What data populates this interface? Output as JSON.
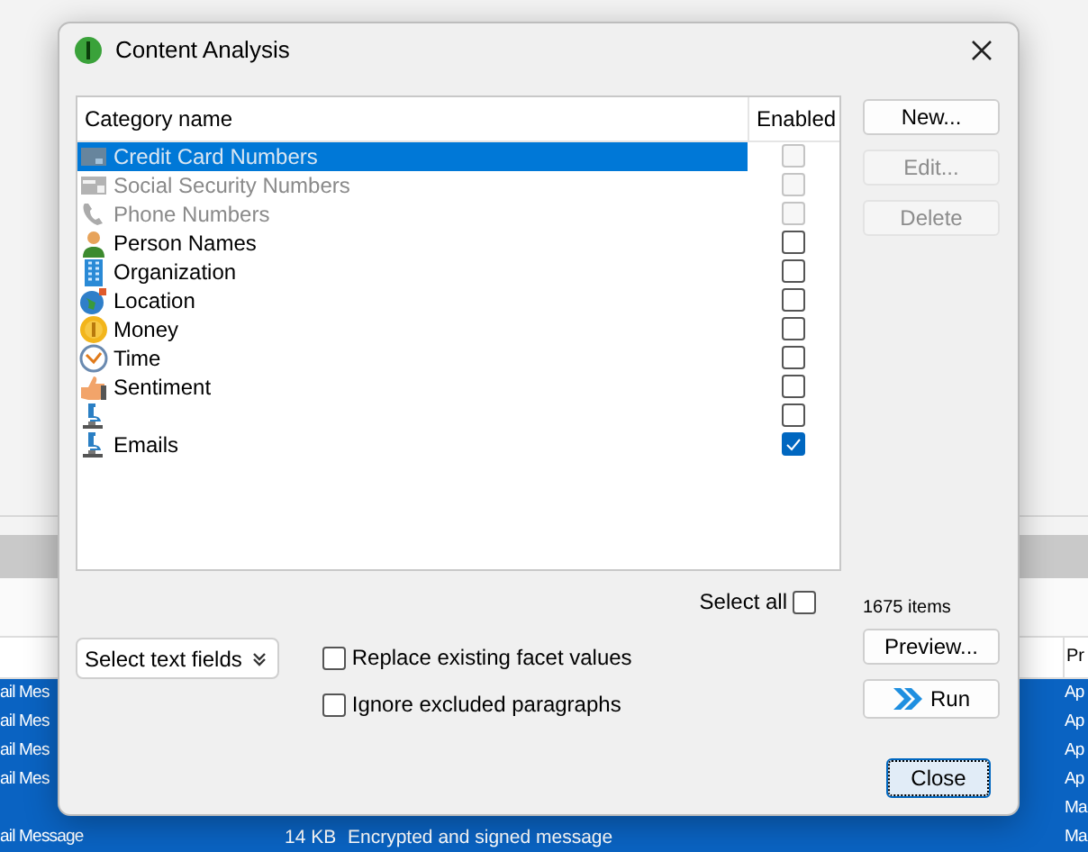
{
  "background": {
    "header_end": "Pr",
    "rows": [
      {
        "cells": [
          "ail Mes"
        ],
        "end": "Ap"
      },
      {
        "cells": [
          "ail Mes"
        ],
        "end": "Ap"
      },
      {
        "cells": [
          "ail Mes"
        ],
        "end": "Ap"
      },
      {
        "cells": [
          "ail Mes"
        ],
        "end": "Ap"
      },
      {
        "cells": [],
        "end": "Ma"
      },
      {
        "cells": [
          "ail Message",
          "14 KB",
          "Encrypted and signed message"
        ],
        "end": "Ma"
      }
    ]
  },
  "window": {
    "title": "Content Analysis"
  },
  "table": {
    "columns": [
      "Category name",
      "Enabled"
    ],
    "rows": [
      {
        "kind": "card",
        "name": "Credit Card Numbers",
        "disabled": true,
        "enabled": false,
        "selected": true
      },
      {
        "kind": "ssn",
        "name": "Social Security Numbers",
        "disabled": true,
        "enabled": false,
        "selected": false
      },
      {
        "kind": "phone",
        "name": "Phone Numbers",
        "disabled": true,
        "enabled": false,
        "selected": false
      },
      {
        "kind": "person",
        "name": "Person Names",
        "disabled": false,
        "enabled": false,
        "selected": false
      },
      {
        "kind": "organization",
        "name": "Organization",
        "disabled": false,
        "enabled": false,
        "selected": false
      },
      {
        "kind": "location",
        "name": "Location",
        "disabled": false,
        "enabled": false,
        "selected": false
      },
      {
        "kind": "money",
        "name": "Money",
        "disabled": false,
        "enabled": false,
        "selected": false
      },
      {
        "kind": "time",
        "name": "Time",
        "disabled": false,
        "enabled": false,
        "selected": false
      },
      {
        "kind": "sentiment",
        "name": "Sentiment",
        "disabled": false,
        "enabled": false,
        "selected": false
      },
      {
        "kind": "custom",
        "disabled": false,
        "enabled": false,
        "selected": false
      },
      {
        "kind": "custom",
        "name": "Emails",
        "disabled": false,
        "enabled": true,
        "selected": false
      }
    ]
  },
  "buttons": [
    {
      "label": "New...",
      "disabled": false
    },
    {
      "label": "Edit...",
      "disabled": true
    },
    {
      "label": "Delete",
      "disabled": true
    }
  ],
  "item_count": "1675 items",
  "preview_button": "Preview...",
  "run_button": "Run",
  "select_all": {
    "label": "Select all",
    "checked": false
  },
  "select_fields_button": "Select text fields",
  "options": [
    {
      "label": "Replace existing facet values",
      "checked": false
    },
    {
      "label": "Ignore excluded paragraphs",
      "checked": false
    }
  ],
  "close_button": "Close"
}
